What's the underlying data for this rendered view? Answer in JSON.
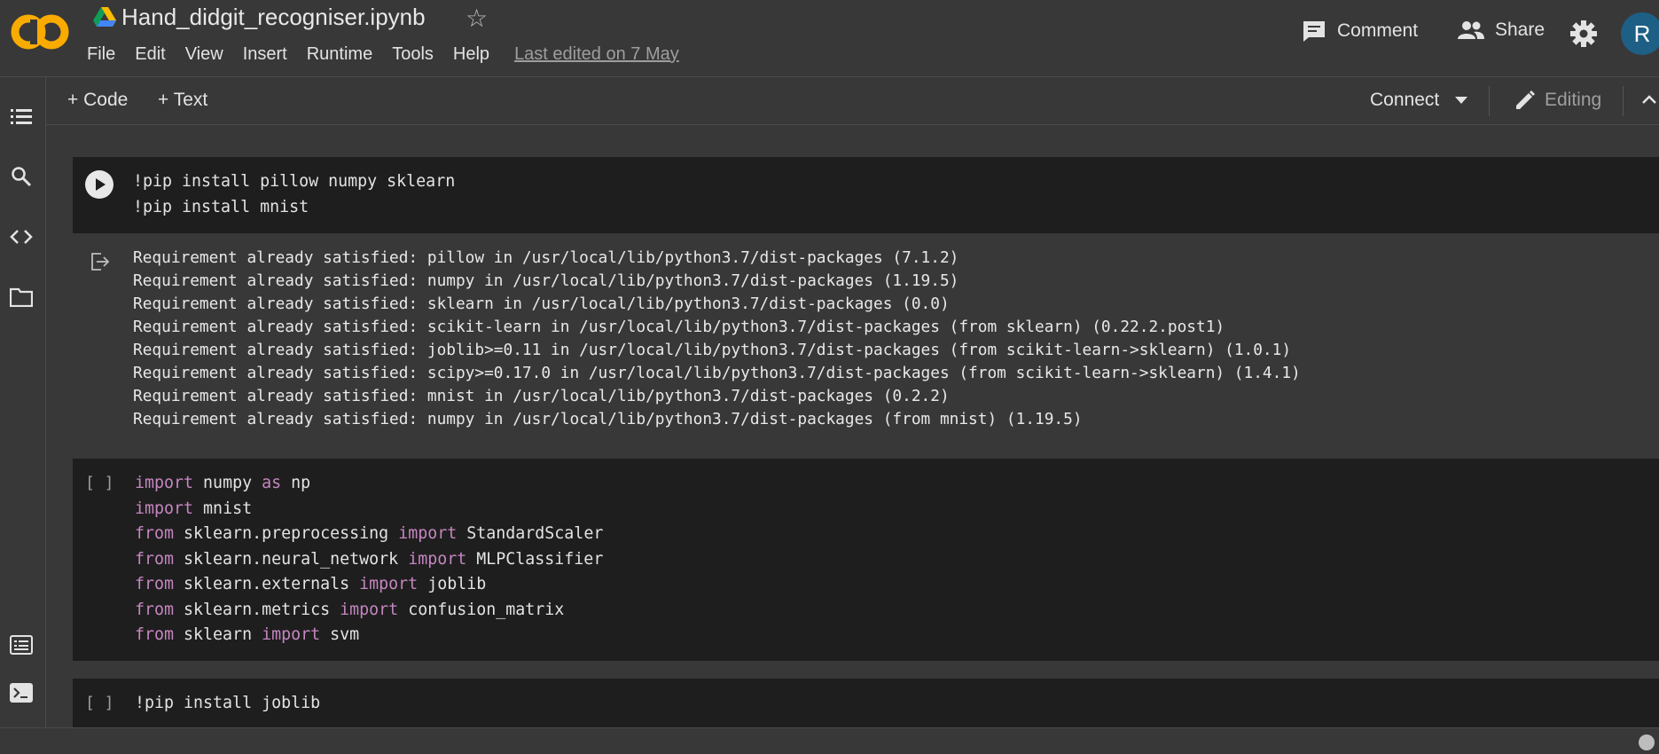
{
  "app": {
    "logo_text": "CO",
    "notebook_title": "Hand_didgit_recogniser.ipynb",
    "menu": [
      "File",
      "Edit",
      "View",
      "Insert",
      "Runtime",
      "Tools",
      "Help"
    ],
    "last_edited": "Last edited on 7 May",
    "comment_label": "Comment",
    "share_label": "Share",
    "avatar_letter": "R"
  },
  "toolbar": {
    "add_code_label": "+ Code",
    "add_text_label": "+ Text",
    "connect_label": "Connect",
    "editing_label": "Editing"
  },
  "cells": {
    "cell1": {
      "code": [
        "!pip install pillow numpy sklearn",
        "!pip install mnist"
      ],
      "output": [
        "Requirement already satisfied: pillow in /usr/local/lib/python3.7/dist-packages (7.1.2)",
        "Requirement already satisfied: numpy in /usr/local/lib/python3.7/dist-packages (1.19.5)",
        "Requirement already satisfied: sklearn in /usr/local/lib/python3.7/dist-packages (0.0)",
        "Requirement already satisfied: scikit-learn in /usr/local/lib/python3.7/dist-packages (from sklearn) (0.22.2.post1)",
        "Requirement already satisfied: joblib>=0.11 in /usr/local/lib/python3.7/dist-packages (from scikit-learn->sklearn) (1.0.1)",
        "Requirement already satisfied: scipy>=0.17.0 in /usr/local/lib/python3.7/dist-packages (from scikit-learn->sklearn) (1.4.1)",
        "Requirement already satisfied: mnist in /usr/local/lib/python3.7/dist-packages (0.2.2)",
        "Requirement already satisfied: numpy in /usr/local/lib/python3.7/dist-packages (from mnist) (1.19.5)"
      ]
    },
    "cell2": {
      "bracket": "[ ]",
      "code": [
        {
          "kw1": "import",
          "t1": " numpy ",
          "kw2": "as",
          "t2": " np"
        },
        {
          "kw1": "import",
          "t1": " mnist",
          "kw2": "",
          "t2": ""
        },
        {
          "kw1": "from",
          "t1": " sklearn.preprocessing ",
          "kw2": "import",
          "t2": " StandardScaler"
        },
        {
          "kw1": "from",
          "t1": " sklearn.neural_network ",
          "kw2": "import",
          "t2": " MLPClassifier"
        },
        {
          "kw1": "from",
          "t1": " sklearn.externals ",
          "kw2": "import",
          "t2": " joblib"
        },
        {
          "kw1": "from",
          "t1": " sklearn.metrics ",
          "kw2": "import",
          "t2": " confusion_matrix"
        },
        {
          "kw1": "from",
          "t1": " sklearn ",
          "kw2": "import",
          "t2": " svm"
        }
      ]
    },
    "cell3": {
      "bracket": "[ ]",
      "code": "!pip install joblib"
    }
  },
  "colors": {
    "background": "#383838",
    "code_cell": "#1e1e1e",
    "keyword": "#c586c0",
    "logo_orange": "#f9ab00",
    "avatar": "#1e5f85"
  }
}
